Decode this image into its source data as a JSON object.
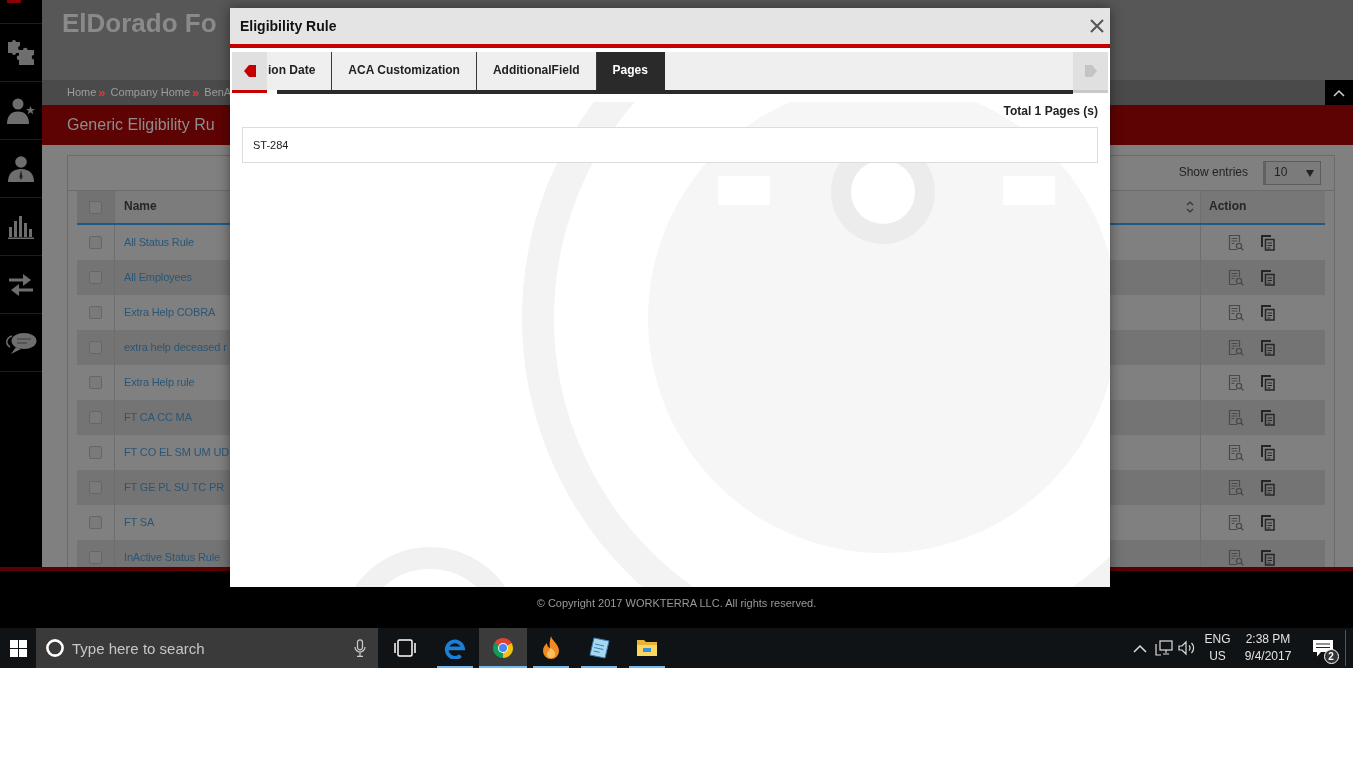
{
  "app_header": {
    "title": "ElDorado Fo"
  },
  "breadcrumb": [
    {
      "label": "Home",
      "separator": "»"
    },
    {
      "label": "Company Home",
      "separator": "»"
    },
    {
      "label": "BenA"
    }
  ],
  "page_title": "Generic Eligibility Ru",
  "table": {
    "show_entries_label": "Show entries",
    "page_size": "10",
    "select_all_checked": false,
    "columns": [
      "Name",
      "Action"
    ],
    "rows": [
      {
        "name": "All Status Rule",
        "checked": false
      },
      {
        "name": "All Employees",
        "checked": false
      },
      {
        "name": "Extra Help COBRA",
        "checked": false
      },
      {
        "name": "extra help deceased r",
        "checked": false
      },
      {
        "name": "Extra Help rule",
        "checked": false
      },
      {
        "name": "FT CA CC MA",
        "checked": false
      },
      {
        "name": "FT CO EL SM UM UD",
        "checked": false
      },
      {
        "name": "FT GE PL SU TC PR",
        "checked": false
      },
      {
        "name": "FT SA",
        "checked": false
      },
      {
        "name": "InActive Status Rule",
        "checked": false
      }
    ]
  },
  "modal": {
    "title": "Eligibility Rule",
    "scroll_buttons": [
      {
        "kind": "left",
        "disabled": false
      },
      {
        "kind": "right",
        "disabled": true
      }
    ],
    "tabs": [
      {
        "label": "ion Date",
        "selected": false
      },
      {
        "label": "ACA Customization",
        "selected": false
      },
      {
        "label": "AdditionalField",
        "selected": false
      },
      {
        "label": "Pages",
        "selected": true
      }
    ],
    "total": "Total 1 Pages (s)",
    "pages": [
      "ST-284"
    ]
  },
  "footer": {
    "copyright": "© Copyright 2017 WORKTERRA LLC. All rights reserved."
  },
  "taskbar": {
    "search": {
      "placeholder": "Type here to search"
    },
    "apps": [
      {
        "kind": "edge",
        "selected": false
      },
      {
        "kind": "chrome",
        "selected": true
      },
      {
        "kind": "flame",
        "selected": false
      },
      {
        "kind": "notepad",
        "selected": false
      },
      {
        "kind": "folder",
        "selected": false
      }
    ],
    "language": "ENG",
    "region": "US",
    "time": "2:38 PM",
    "date": "9/4/2017",
    "notifications": "2"
  }
}
